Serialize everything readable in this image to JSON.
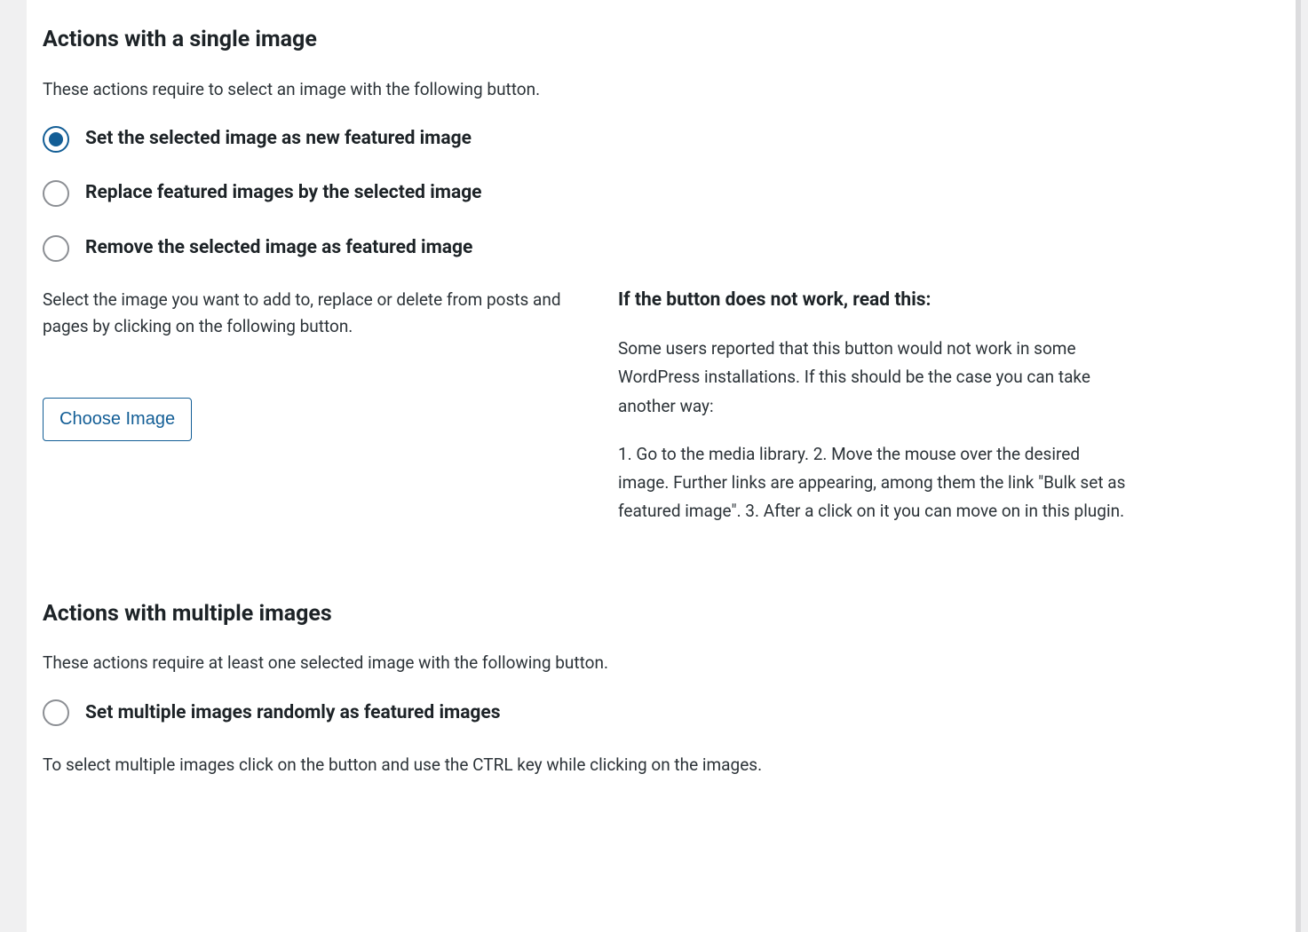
{
  "single": {
    "heading": "Actions with a single image",
    "intro": "These actions require to select an image with the following button.",
    "options": {
      "set": "Set the selected image as new featured image",
      "replace": "Replace featured images by the selected image",
      "remove": "Remove the selected image as featured image"
    },
    "select_hint": "Select the image you want to add to, replace or delete from posts and pages by clicking on the following button.",
    "choose_button": "Choose Image",
    "help": {
      "heading": "If the button does not work, read this:",
      "p1": "Some users reported that this button would not work in some WordPress installations. If this should be the case you can take another way:",
      "p2": "1. Go to the media library. 2. Move the mouse over the desired image. Further links are appearing, among them the link \"Bulk set as featured image\". 3. After a click on it you can move on in this plugin."
    }
  },
  "multiple": {
    "heading": "Actions with multiple images",
    "intro": "These actions require at least one selected image with the following button.",
    "options": {
      "random": "Set multiple images randomly as featured images"
    },
    "select_hint": "To select multiple images click on the button and use the CTRL key while clicking on the images."
  }
}
